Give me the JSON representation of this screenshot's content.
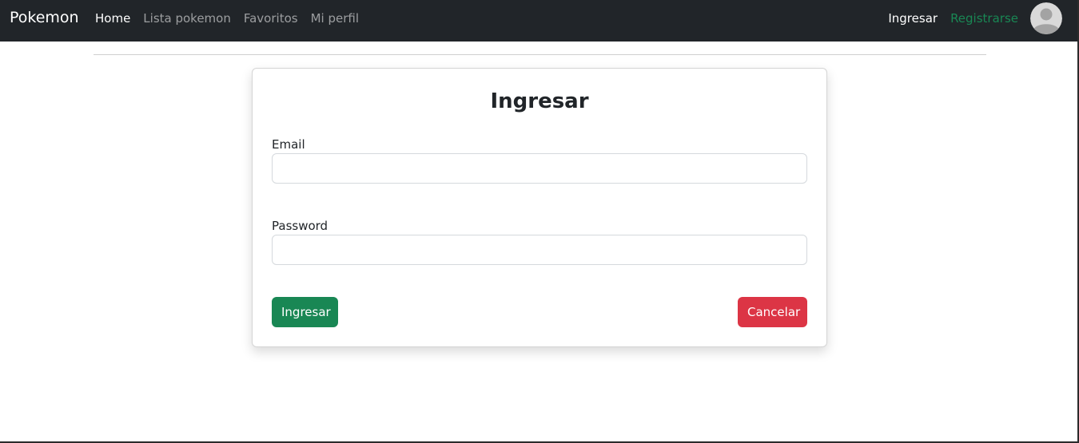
{
  "navbar": {
    "brand": "Pokemon",
    "links": [
      {
        "label": "Home",
        "active": true
      },
      {
        "label": "Lista pokemon",
        "active": false
      },
      {
        "label": "Favoritos",
        "active": false
      },
      {
        "label": "Mi perfil",
        "active": false
      }
    ],
    "login_label": "Ingresar",
    "register_label": "Registrarse",
    "avatar_icon": "user-avatar-icon"
  },
  "login_card": {
    "title": "Ingresar",
    "email": {
      "label": "Email",
      "value": "",
      "placeholder": ""
    },
    "password": {
      "label": "Password",
      "value": "",
      "placeholder": ""
    },
    "submit_label": "Ingresar",
    "cancel_label": "Cancelar"
  },
  "colors": {
    "navbar_bg": "#212529",
    "success": "#198754",
    "danger": "#dc3545"
  }
}
